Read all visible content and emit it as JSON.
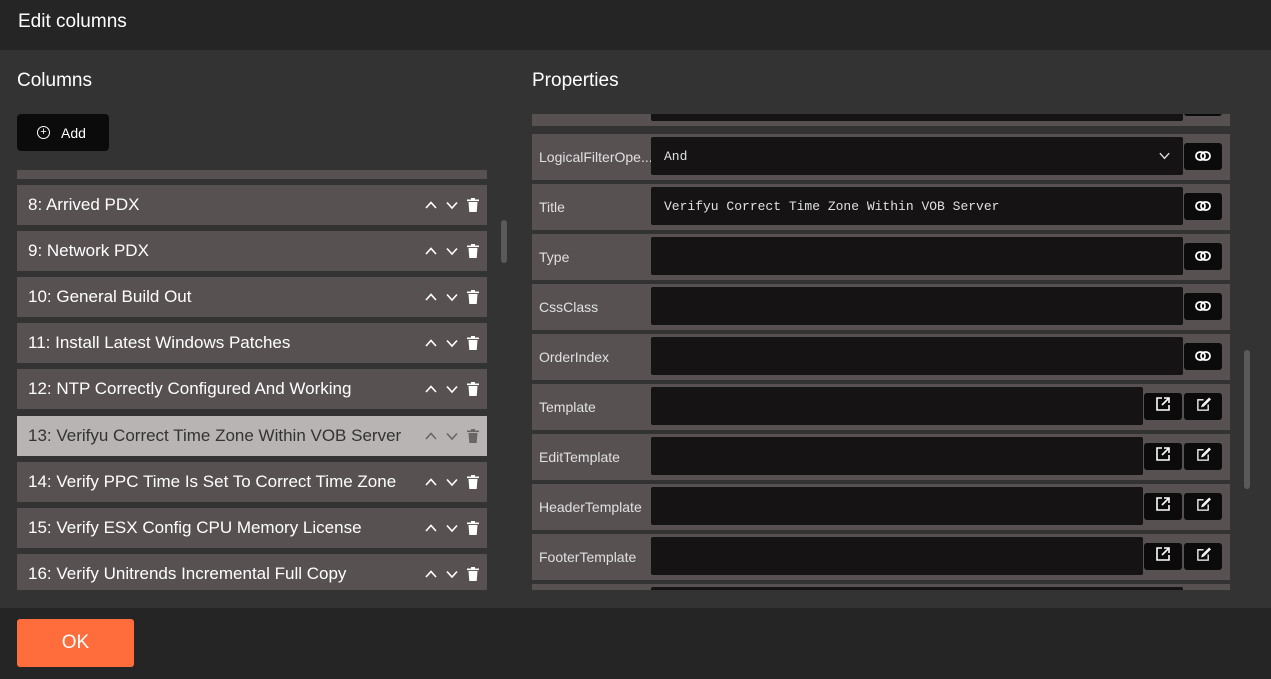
{
  "dialog": {
    "title": "Edit columns"
  },
  "columns_panel": {
    "heading": "Columns",
    "add_label": "Add",
    "items": [
      {
        "label": "8: Arrived PDX",
        "selected": false
      },
      {
        "label": "9: Network PDX",
        "selected": false
      },
      {
        "label": "10: General Build Out",
        "selected": false
      },
      {
        "label": "11: Install Latest Windows Patches",
        "selected": false
      },
      {
        "label": "12: NTP Correctly Configured And Working",
        "selected": false
      },
      {
        "label": "13: Verifyu Correct Time Zone Within VOB Server",
        "selected": true
      },
      {
        "label": "14: Verify PPC Time Is Set To Correct Time Zone",
        "selected": false
      },
      {
        "label": "15: Verify ESX Config CPU Memory License",
        "selected": false
      },
      {
        "label": "16: Verify Unitrends Incremental Full Copy",
        "selected": false
      }
    ]
  },
  "properties_panel": {
    "heading": "Properties",
    "rows": [
      {
        "label": "LogicalFilterOpe...",
        "value": "And",
        "kind": "select"
      },
      {
        "label": "Title",
        "value": "Verifyu Correct Time Zone Within VOB Server",
        "kind": "text"
      },
      {
        "label": "Type",
        "value": "",
        "kind": "text"
      },
      {
        "label": "CssClass",
        "value": "",
        "kind": "text"
      },
      {
        "label": "OrderIndex",
        "value": "",
        "kind": "text"
      },
      {
        "label": "Template",
        "value": "",
        "kind": "template"
      },
      {
        "label": "EditTemplate",
        "value": "",
        "kind": "template"
      },
      {
        "label": "HeaderTemplate",
        "value": "",
        "kind": "template"
      },
      {
        "label": "FooterTemplate",
        "value": "",
        "kind": "template"
      }
    ]
  },
  "footer": {
    "ok_label": "OK"
  },
  "colors": {
    "accent": "#ff6d3d",
    "row_bg": "#575152",
    "selected_bg": "#b8b4b3",
    "field_bg": "#151314"
  }
}
